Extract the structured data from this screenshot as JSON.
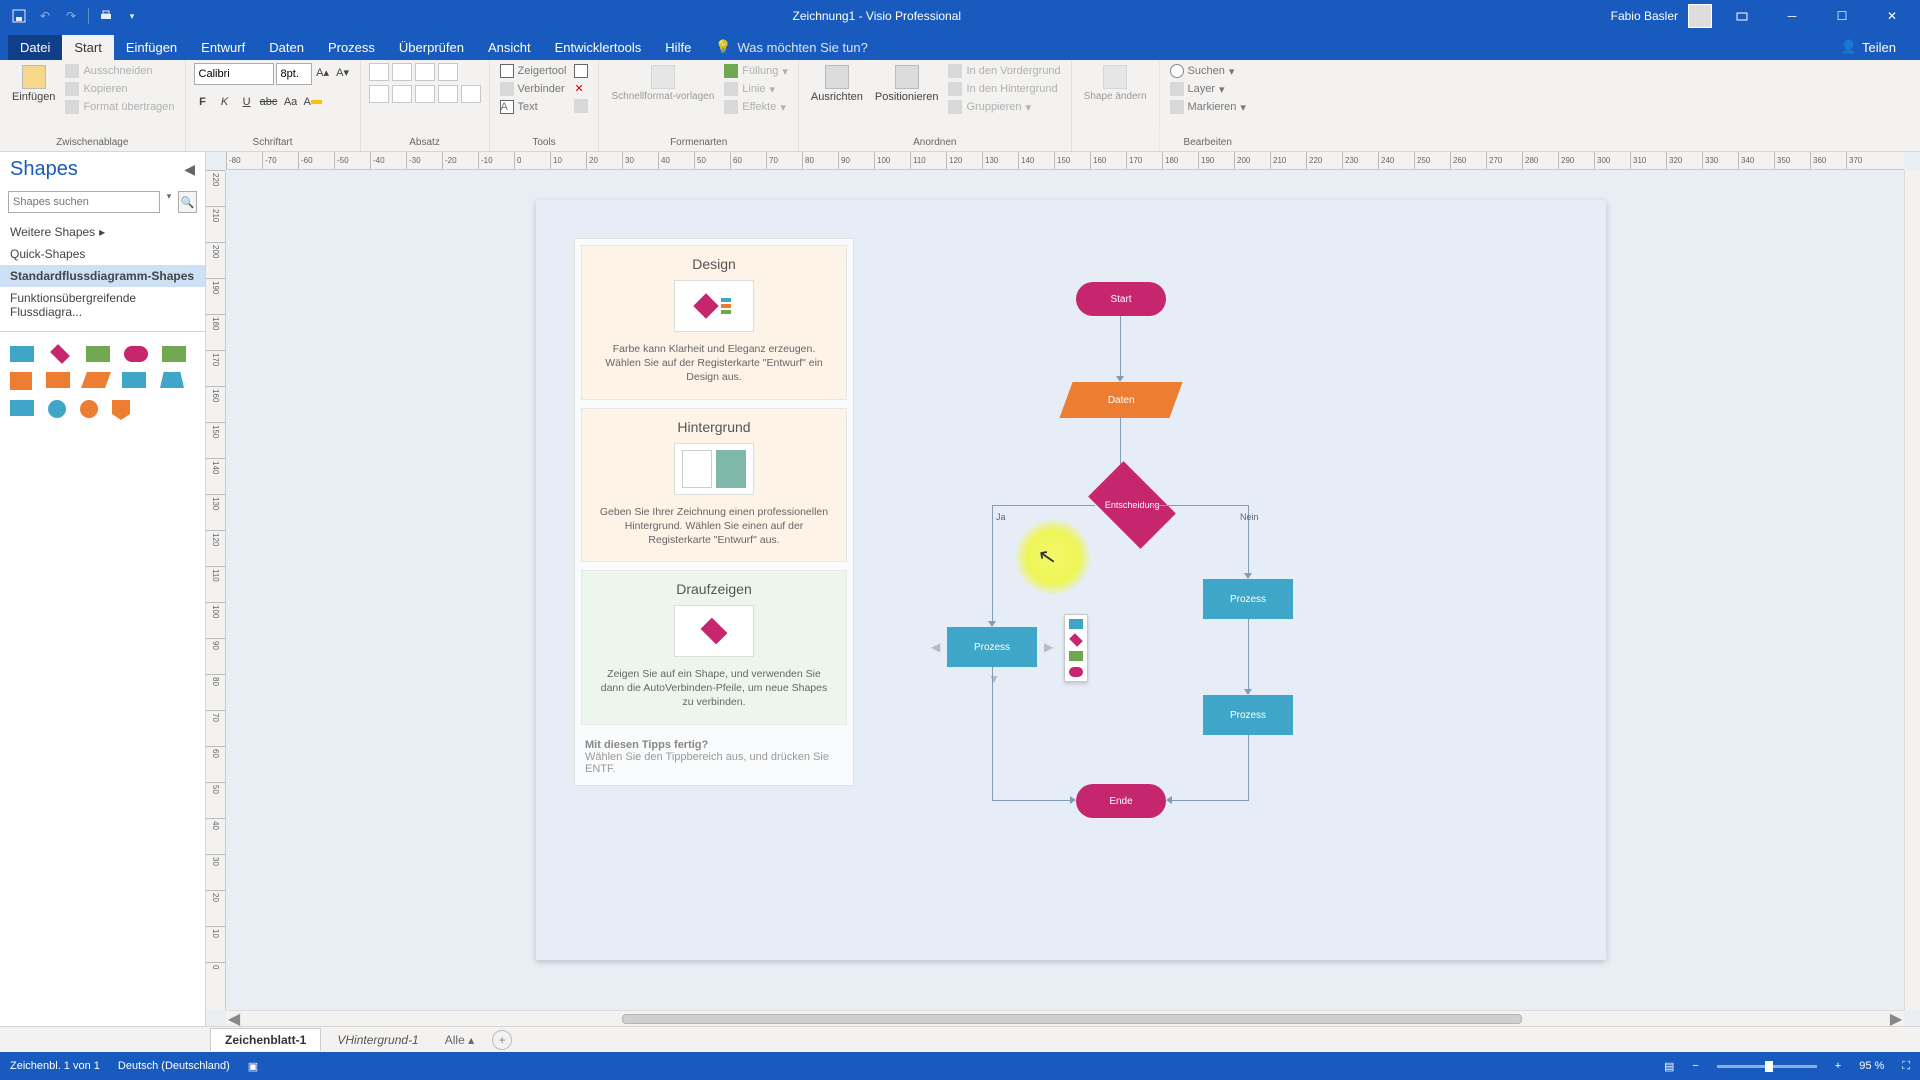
{
  "title": "Zeichnung1 - Visio Professional",
  "user": "Fabio Basler",
  "share": "Teilen",
  "tabs": {
    "file": "Datei",
    "home": "Start",
    "insert": "Einfügen",
    "design": "Entwurf",
    "data": "Daten",
    "process": "Prozess",
    "review": "Überprüfen",
    "view": "Ansicht",
    "developer": "Entwicklertools",
    "help": "Hilfe",
    "tellme": "Was möchten Sie tun?"
  },
  "ribbon": {
    "clipboard": {
      "label": "Zwischenablage",
      "paste": "Einfügen",
      "cut": "Ausschneiden",
      "copy": "Kopieren",
      "format": "Format übertragen"
    },
    "font": {
      "label": "Schriftart",
      "name": "Calibri",
      "size": "8pt."
    },
    "paragraph": {
      "label": "Absatz"
    },
    "tools": {
      "label": "Tools",
      "pointer": "Zeigertool",
      "connector": "Verbinder",
      "text": "Text"
    },
    "shapestyles": {
      "label": "Formenarten",
      "quick": "Schnellformat-vorlagen",
      "fill": "Füllung",
      "line": "Linie",
      "effects": "Effekte"
    },
    "arrange": {
      "label": "Anordnen",
      "align": "Ausrichten",
      "position": "Positionieren",
      "front": "In den Vordergrund",
      "back": "In den Hintergrund",
      "group": "Gruppieren"
    },
    "changeshape": {
      "btn": "Shape ändern"
    },
    "editing": {
      "label": "Bearbeiten",
      "find": "Suchen",
      "layer": "Layer",
      "select": "Markieren"
    }
  },
  "shapesPanel": {
    "title": "Shapes",
    "searchPlaceholder": "Shapes suchen",
    "more": "Weitere Shapes",
    "quick": "Quick-Shapes",
    "basicFlow": "Standardflussdiagramm-Shapes",
    "crossFunc": "Funktionsübergreifende Flussdiagra..."
  },
  "tips": {
    "design": {
      "title": "Design",
      "text": "Farbe kann Klarheit und Eleganz erzeugen. Wählen Sie auf der Registerkarte \"Entwurf\" ein Design aus."
    },
    "background": {
      "title": "Hintergrund",
      "text": "Geben Sie Ihrer Zeichnung einen professionellen Hintergrund. Wählen Sie einen auf der Registerkarte \"Entwurf\" aus."
    },
    "hover": {
      "title": "Draufzeigen",
      "text": "Zeigen Sie auf ein Shape, und verwenden Sie dann die AutoVerbinden-Pfeile, um neue Shapes zu verbinden."
    },
    "done": {
      "heading": "Mit diesen Tipps fertig?",
      "body": "Wählen Sie den Tippbereich aus, und drücken Sie ENTF."
    }
  },
  "flowchart": {
    "start": "Start",
    "data": "Daten",
    "decision": "Entscheidung",
    "yes": "Ja",
    "no": "Nein",
    "process": "Prozess",
    "end": "Ende"
  },
  "pageTabs": {
    "page1": "Zeichenblatt-1",
    "bg1": "VHintergrund-1",
    "all": "Alle"
  },
  "status": {
    "pagecount": "Zeichenbl. 1 von 1",
    "lang": "Deutsch (Deutschland)",
    "zoom": "95 %"
  },
  "rulerH": [
    "-80",
    "-70",
    "-60",
    "-50",
    "-40",
    "-30",
    "-20",
    "-10",
    "0",
    "10",
    "20",
    "30",
    "40",
    "50",
    "60",
    "70",
    "80",
    "90",
    "100",
    "110",
    "120",
    "130",
    "140",
    "150",
    "160",
    "170",
    "180",
    "190",
    "200",
    "210",
    "220",
    "230",
    "240",
    "250",
    "260",
    "270",
    "280",
    "290",
    "300",
    "310",
    "320",
    "330",
    "340",
    "350",
    "360",
    "370"
  ],
  "rulerV": [
    "220",
    "210",
    "200",
    "190",
    "180",
    "170",
    "160",
    "150",
    "140",
    "130",
    "120",
    "110",
    "100",
    "90",
    "80",
    "70",
    "60",
    "50",
    "40",
    "30",
    "20",
    "10",
    "0"
  ]
}
